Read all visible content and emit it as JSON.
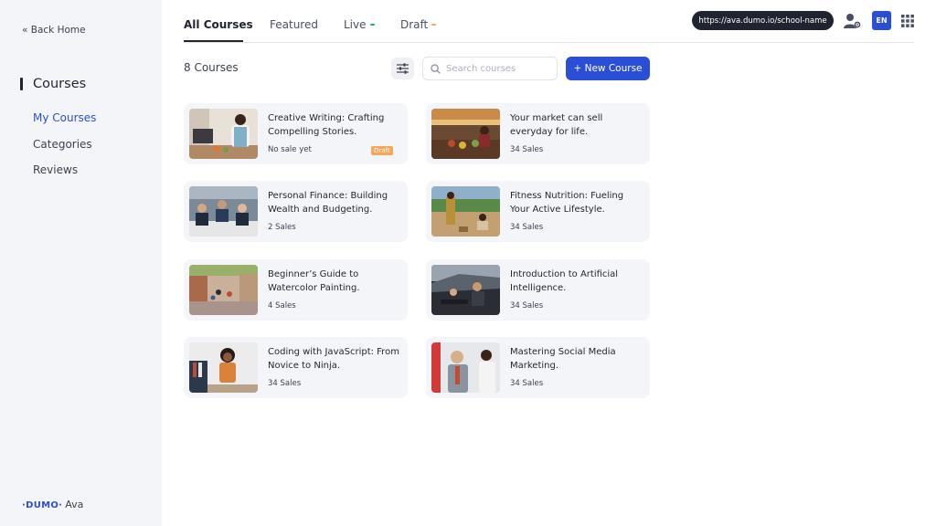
{
  "sidebar": {
    "back_home": "« Back Home",
    "section_title": "Courses",
    "items": [
      {
        "label": "My Courses",
        "active": true
      },
      {
        "label": "Categories",
        "active": false
      },
      {
        "label": "Reviews",
        "active": false
      }
    ],
    "brand_mark": "·DUMO·",
    "brand_name": "Ava"
  },
  "tabs": [
    {
      "label": "All Courses",
      "active": true,
      "dot": ""
    },
    {
      "label": "Featured",
      "active": false,
      "dot": ""
    },
    {
      "label": "Live",
      "active": false,
      "dot": "#27ae60"
    },
    {
      "label": "Draft",
      "active": false,
      "dot": "#f5a85c"
    }
  ],
  "topbar": {
    "school_url": "https://ava.dumo.io/school-name",
    "language": "EN",
    "user_icon": "user-gear-icon",
    "apps_icon": "grid-icon"
  },
  "toolbar": {
    "count_label": "8 Courses",
    "search_placeholder": "Search courses",
    "new_course_label": "+ New Course"
  },
  "colors": {
    "accent": "#2a4fd6",
    "draft": "#f5a85c",
    "live": "#27ae60"
  },
  "courses": [
    {
      "title": "Creative Writing: Crafting Compelling Stories.",
      "sales": "No sale yet",
      "badge": "Draft"
    },
    {
      "title": "Your market can sell everyday for life.",
      "sales": "34 Sales",
      "badge": ""
    },
    {
      "title": "Personal Finance: Building Wealth and Budgeting.",
      "sales": "2 Sales",
      "badge": ""
    },
    {
      "title": "Fitness Nutrition: Fueling Your Active Lifestyle.",
      "sales": "34 Sales",
      "badge": ""
    },
    {
      "title": "Beginner’s Guide to Watercolor Painting.",
      "sales": "4 Sales",
      "badge": ""
    },
    {
      "title": "Introduction to Artificial Intelligence.",
      "sales": "34 Sales",
      "badge": ""
    },
    {
      "title": "Coding with JavaScript: From Novice to Ninja.",
      "sales": "34 Sales",
      "badge": ""
    },
    {
      "title": "Mastering Social Media Marketing.",
      "sales": "34 Sales",
      "badge": ""
    }
  ]
}
